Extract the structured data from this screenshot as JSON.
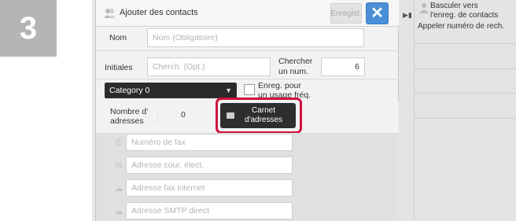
{
  "step": {
    "number": "3"
  },
  "dialog": {
    "title": "Ajouter des contacts",
    "save_label": "Enregist.",
    "close_label": "✕"
  },
  "form": {
    "name_label": "Nom",
    "name_placeholder": "Nom (Obligatoire)",
    "initials_label": "Initiales",
    "initials_placeholder": "Cherch. (Opt.)",
    "search_num_label_1": "Chercher",
    "search_num_label_2": "un num.",
    "search_num_value": "6",
    "category_value": "Category 0",
    "frequent_label_1": "Enreg. pour",
    "frequent_label_2": "un usage fréq.",
    "address_count_label_1": "Nombre d'",
    "address_count_label_2": "adresses",
    "address_count_value": "0",
    "address_book_label_1": "Carnet",
    "address_book_label_2": "d'adresses",
    "fax_placeholder": "Numéro de fax",
    "email_placeholder": "Adresse cour. élect.",
    "ifax_placeholder": "Adresse fax internet",
    "smtp_placeholder": "Adresse SMTP direct"
  },
  "side_panel": {
    "switch_line_1": "Basculer vers",
    "switch_line_2": "l'enreg. de contacts",
    "call_number": "Appeler numéro de rech."
  },
  "colors": {
    "accent_blue": "#4a8fd8",
    "highlight_red": "#d0113b",
    "dark_button": "#2e2e2e"
  }
}
